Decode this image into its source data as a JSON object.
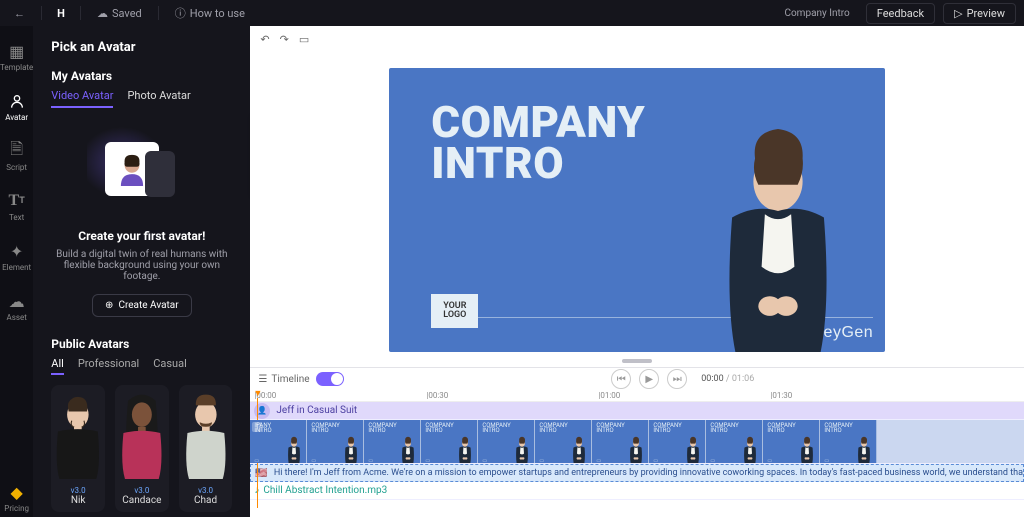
{
  "topbar": {
    "saved": "Saved",
    "how_to_use": "How to use",
    "project_name": "Company Intro",
    "feedback": "Feedback",
    "preview": "Preview"
  },
  "leftnav": {
    "items": [
      {
        "id": "template",
        "label": "Template"
      },
      {
        "id": "avatar",
        "label": "Avatar"
      },
      {
        "id": "script",
        "label": "Script"
      },
      {
        "id": "text",
        "label": "Text"
      },
      {
        "id": "element",
        "label": "Element"
      },
      {
        "id": "asset",
        "label": "Asset"
      }
    ],
    "pricing_label": "Pricing"
  },
  "panel": {
    "title": "Pick an Avatar",
    "my_avatars_label": "My Avatars",
    "tabs": {
      "video": "Video Avatar",
      "photo": "Photo Avatar"
    },
    "empty": {
      "headline": "Create your first avatar!",
      "description": "Build a digital twin of real humans with flexible background using your own footage.",
      "cta": "Create Avatar"
    },
    "public_label": "Public Avatars",
    "public_tabs": {
      "all": "All",
      "professional": "Professional",
      "casual": "Casual"
    },
    "avatars": [
      {
        "name": "Nik",
        "version": "v3.0"
      },
      {
        "name": "Candace",
        "version": "v3.0"
      },
      {
        "name": "Chad",
        "version": "v3.0"
      }
    ]
  },
  "slide": {
    "line1": "COMPANY",
    "line2": "INTRO",
    "logo_l1": "YOUR",
    "logo_l2": "LOGO",
    "brand": "HeyGen"
  },
  "timeline": {
    "label": "Timeline",
    "time_current": "00:00",
    "time_total": "01:06",
    "avatar_track": "Jeff in Casual Suit",
    "script_text": "Hi there! I'm Jeff from Acme. We're on a mission to empower startups and entrepreneurs by providing innovative coworking spaces. In today's fast-paced business world, we understand tha",
    "audio_name": "Chill Abstract Intention.mp3",
    "ruler": [
      "|00:00",
      "|00:30",
      "|01:00",
      "|01:30"
    ],
    "thumb_line1": "IPANY",
    "thumb_line2": "INTRO",
    "thumb_full1": "COMPANY",
    "thumb_full2": "INTRO",
    "scene_num": "1"
  }
}
